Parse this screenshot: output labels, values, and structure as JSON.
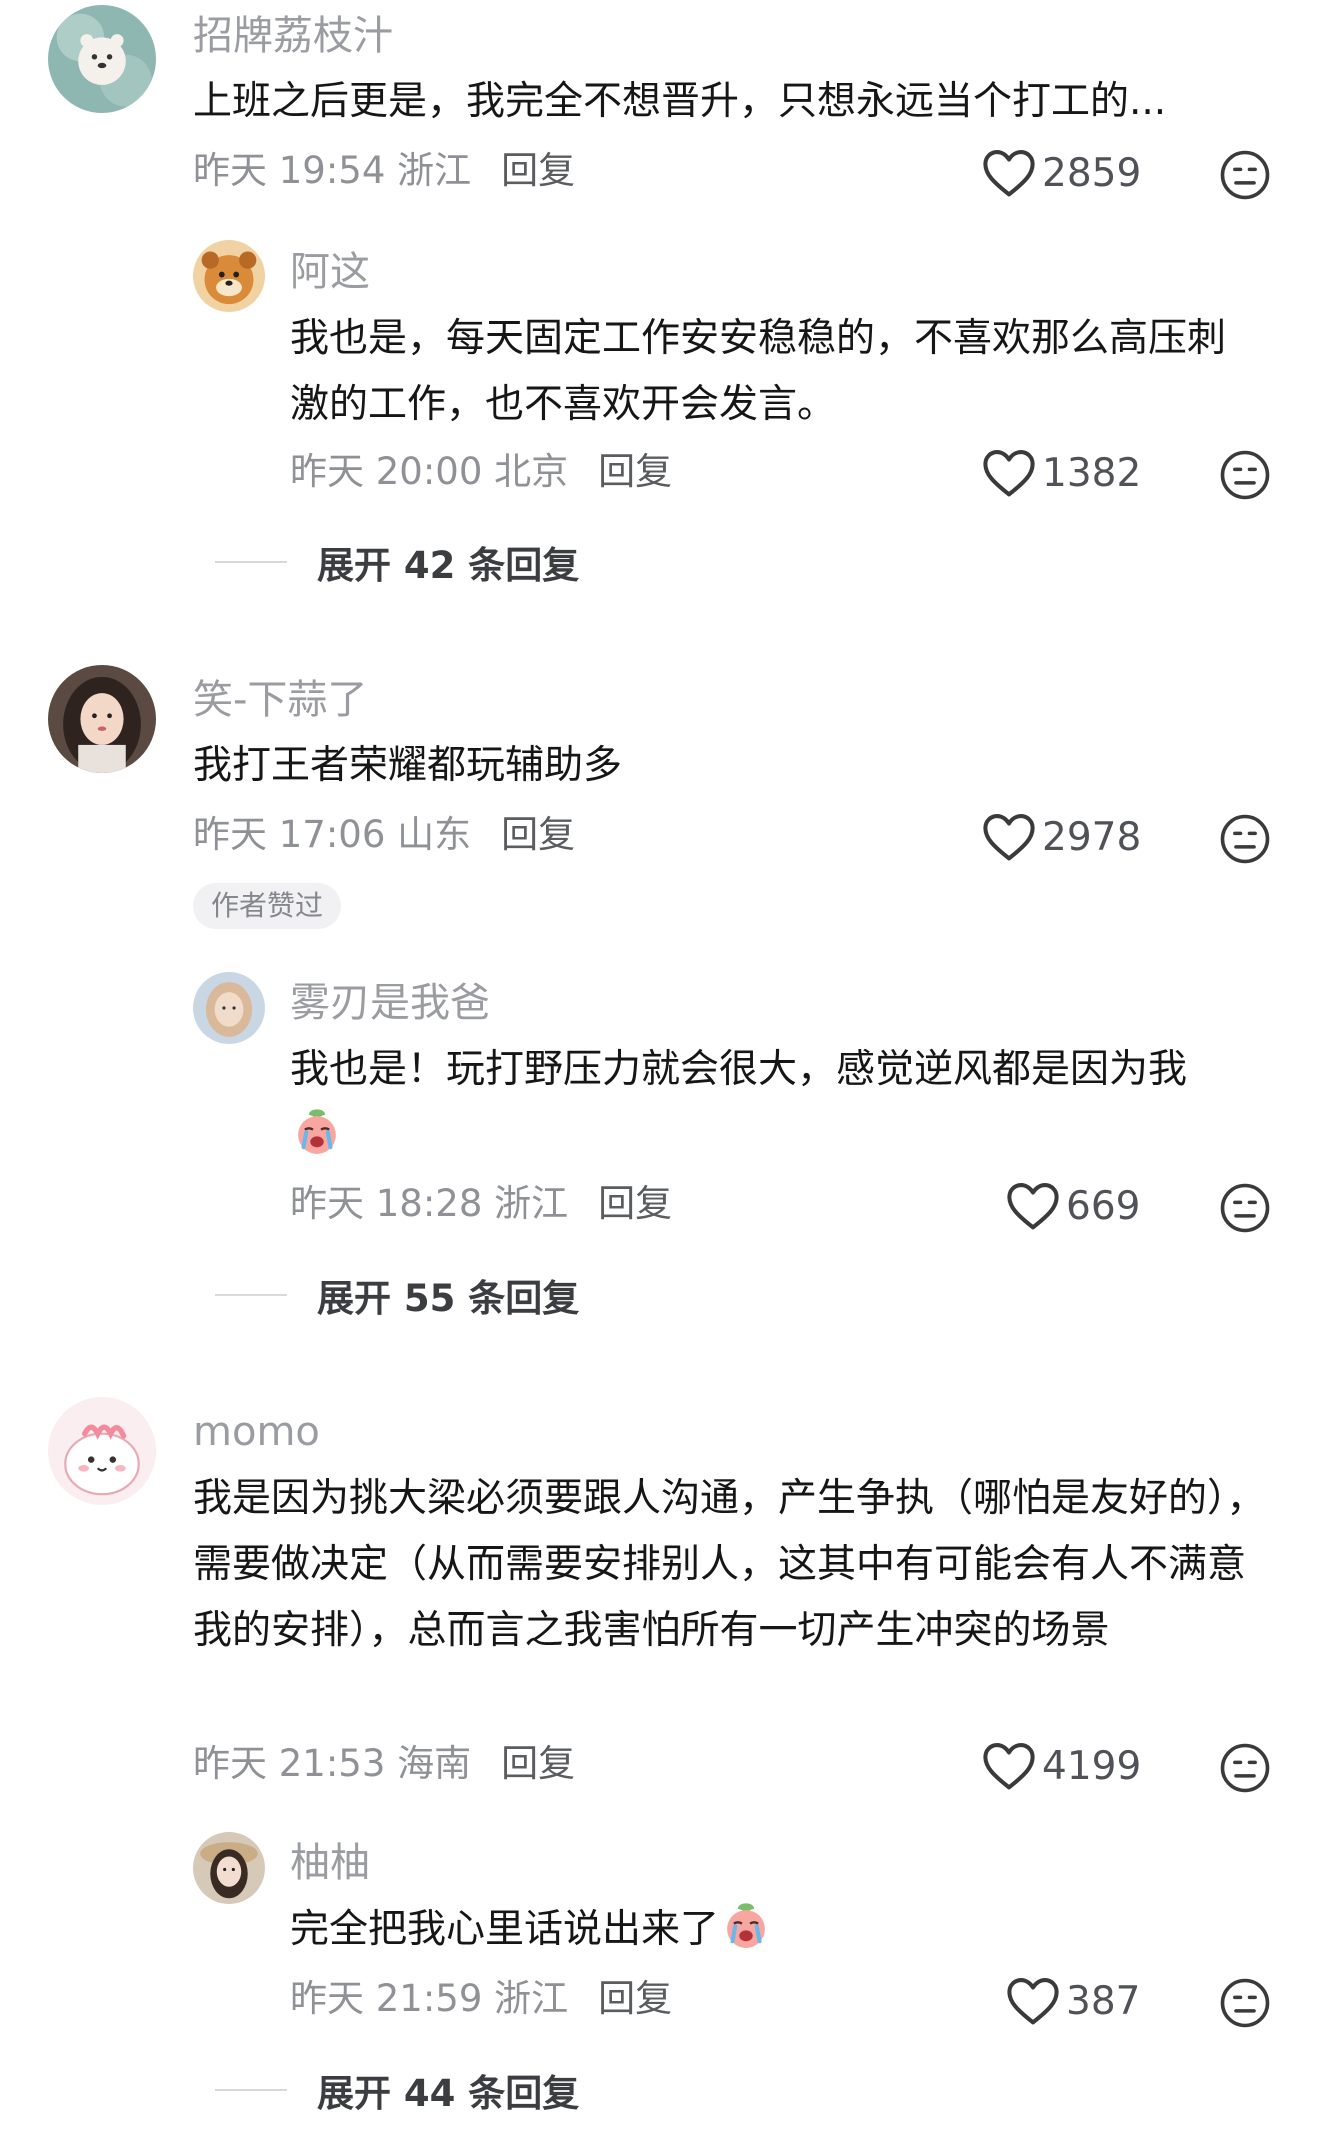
{
  "comments": [
    {
      "username": "招牌荔枝汁",
      "text": "上班之后更是，我完全不想晋升，只想永远当个打工的...",
      "time": "昨天 19:54 浙江",
      "reply": "回复",
      "likes": "2859",
      "replies": [
        {
          "username": "阿这",
          "text": "我也是，每天固定工作安安稳稳的，不喜欢那么高压刺激的工作，也不喜欢开会发言。",
          "time": "昨天 20:00 北京",
          "reply": "回复",
          "likes": "1382"
        }
      ],
      "expand": "展开 42 条回复"
    },
    {
      "username": "笑-下蒜了",
      "text": "我打王者荣耀都玩辅助多",
      "time": "昨天 17:06 山东",
      "reply": "回复",
      "likes": "2978",
      "badge": "作者赞过",
      "replies": [
        {
          "username": "雾刃是我爸",
          "text": "我也是！玩打野压力就会很大，感觉逆风都是因为我",
          "emoji": "crying-face-emoji",
          "time": "昨天 18:28 浙江",
          "reply": "回复",
          "likes": "669"
        }
      ],
      "expand": "展开 55 条回复"
    },
    {
      "username": "momo",
      "text": "我是因为挑大梁必须要跟人沟通，产生争执（哪怕是友好的），需要做决定（从而需要安排别人，这其中有可能会有人不满意我的安排），总而言之我害怕所有一切产生冲突的场景",
      "time": "昨天 21:53 海南",
      "reply": "回复",
      "likes": "4199",
      "replies": [
        {
          "username": "柚柚",
          "text": "完全把我心里话说出来了",
          "emoji": "crying-face-emoji",
          "time": "昨天 21:59 浙江",
          "reply": "回复",
          "likes": "387"
        }
      ],
      "expand": "展开 44 条回复"
    }
  ],
  "icons": {
    "like": "heart-outline-icon",
    "dislike": "dislike-face-icon"
  },
  "colors": {
    "username": "#9a9ca1",
    "text": "#161616",
    "meta": "#8f9196",
    "divider": "#d9d9d9"
  }
}
